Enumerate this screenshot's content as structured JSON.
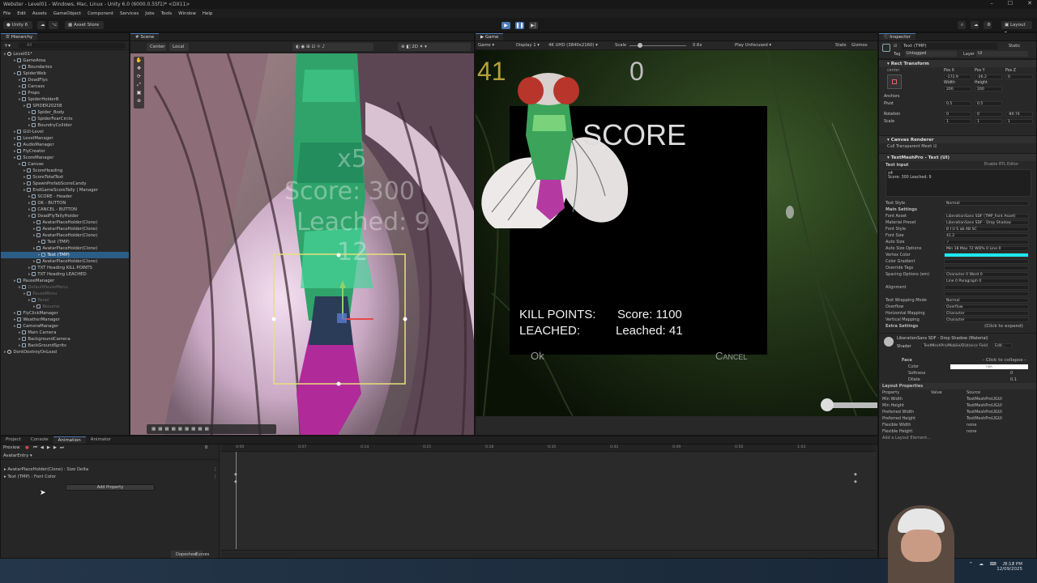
{
  "window": {
    "title": "Webster - Level01 - Windows, Mac, Linux - Unity 6.0 (6000.0.55f1)* <DX11>"
  },
  "menu": [
    "File",
    "Edit",
    "Assets",
    "GameObject",
    "Component",
    "Services",
    "Jobs",
    "Tools",
    "Window",
    "Help"
  ],
  "toolbar": {
    "account": "Unity 6",
    "asset_store": "Asset Store",
    "layout": "Layout"
  },
  "hierarchy": {
    "tab": "Hierarchy",
    "search_placeholder": "All",
    "items": [
      {
        "label": "Level01*",
        "d": 0,
        "t": "scene"
      },
      {
        "label": "GameArea",
        "d": 2
      },
      {
        "label": "Boundaries",
        "d": 3
      },
      {
        "label": "SpiderWeb",
        "d": 2
      },
      {
        "label": "DeadFlys",
        "d": 3
      },
      {
        "label": "Carcass",
        "d": 3
      },
      {
        "label": "Props",
        "d": 3
      },
      {
        "label": "SpiderHolderB",
        "d": 3
      },
      {
        "label": "SPIDER2025B",
        "d": 4
      },
      {
        "label": "Spider_Body",
        "d": 5
      },
      {
        "label": "SpiderFearCircle",
        "d": 5
      },
      {
        "label": "BoundryCollider",
        "d": 5
      },
      {
        "label": "GUI-Level",
        "d": 2
      },
      {
        "label": "LevelManager",
        "d": 2
      },
      {
        "label": "AudioManager",
        "d": 2
      },
      {
        "label": "FlyCreator",
        "d": 2
      },
      {
        "label": "ScoreManager",
        "d": 2
      },
      {
        "label": "Canvas",
        "d": 3
      },
      {
        "label": "ScoreHeading",
        "d": 4
      },
      {
        "label": "ScoreTotalText",
        "d": 4
      },
      {
        "label": "SpawnPrefabScoreCandy",
        "d": 4
      },
      {
        "label": "EndGameScoreTally | Manager",
        "d": 4
      },
      {
        "label": "SCORE - Header",
        "d": 5
      },
      {
        "label": "OK - BUTTON",
        "d": 5
      },
      {
        "label": "CANCEL - BUTTON",
        "d": 5
      },
      {
        "label": "DeadFlyTallyHolder",
        "d": 5
      },
      {
        "label": "AvatarPlaceHolder(Clone)",
        "d": 6
      },
      {
        "label": "AvatarPlaceHolder(Clone)",
        "d": 6
      },
      {
        "label": "AvatarPlaceHolder(Clone)",
        "d": 6
      },
      {
        "label": "Text (TMP)",
        "d": 7
      },
      {
        "label": "AvatarPlaceHolder(Clone)",
        "d": 6
      },
      {
        "label": "Text (TMP)",
        "d": 7,
        "sel": true
      },
      {
        "label": "AvatarPlaceHolder(Clone)",
        "d": 6
      },
      {
        "label": "TXT Heading KILL POINTS",
        "d": 5
      },
      {
        "label": "TXT Heading LEACHED",
        "d": 5
      },
      {
        "label": "PauseManager",
        "d": 2
      },
      {
        "label": "DefaultPauseMenu",
        "d": 3,
        "dim": true
      },
      {
        "label": "PauseMenu",
        "d": 4,
        "dim": true
      },
      {
        "label": "Panel",
        "d": 5,
        "dim": true
      },
      {
        "label": "Resume",
        "d": 6,
        "dim": true
      },
      {
        "label": "FlyClickManager",
        "d": 2
      },
      {
        "label": "WeatherManager",
        "d": 2
      },
      {
        "label": "CameraManager",
        "d": 2
      },
      {
        "label": "Main Camera",
        "d": 3
      },
      {
        "label": "BackgroundCamera",
        "d": 3
      },
      {
        "label": "BackGroundSprits",
        "d": 3
      },
      {
        "label": "DontDestroyOnLoad",
        "d": 0,
        "t": "scene"
      }
    ]
  },
  "scene": {
    "tab": "Scene",
    "pivot": "Center",
    "space": "Local",
    "ghost_lines": [
      "x5",
      "Score: 300",
      "Leached: 9",
      "12"
    ]
  },
  "game": {
    "tab": "Game",
    "mode": "Game",
    "display": "Display 1",
    "resolution": "4K UHD (3840x2160)",
    "scale_label": "Scale",
    "scale_value": "0.6x",
    "play_focus": "Play Unfocused",
    "stats": "Stats",
    "gizmos": "Gizmos",
    "counter_left": "41",
    "counter_center": "0",
    "dialog": {
      "title": "SCORE",
      "kill_label": "KILL POINTS:",
      "kill_value": "Score: 1100",
      "leached_label": "LEACHED:",
      "leached_value": "Leached: 41",
      "ok": "Ok",
      "cancel": "Cancel"
    }
  },
  "inspector": {
    "tab": "Inspector",
    "object_name": "Text (TMP)",
    "static": "Static",
    "tag_label": "Tag",
    "tag": "Untagged",
    "layer_label": "Layer",
    "layer": "UI",
    "rect": {
      "title": "Rect Transform",
      "anchor_label": "center",
      "pos_labels": [
        "Pos X",
        "Pos Y",
        "Pos Z"
      ],
      "pos": [
        "-172.9",
        "-26.2",
        "0"
      ],
      "size_labels": [
        "Width",
        "Height"
      ],
      "size": [
        "200",
        "200"
      ],
      "anchors": "Anchors",
      "pivot_label": "Pivot",
      "pivot": [
        "0.5",
        "0.5"
      ],
      "rotation_label": "Rotation",
      "rotation": [
        "0",
        "0",
        "-80.74"
      ],
      "scale_label": "Scale",
      "scale": [
        "1",
        "1",
        "1"
      ]
    },
    "canvas_renderer": {
      "title": "Canvas Renderer",
      "cull": "Cull Transparent Mesh"
    },
    "tmp": {
      "title": "TextMeshPro - Text (UI)",
      "text_input": "Text Input",
      "rtl": "Enable RTL Editor",
      "text_lines": [
        "x4",
        "Score: 300  Leached: 9"
      ],
      "text_style_label": "Text Style",
      "text_style": "Normal",
      "main_settings": "Main Settings",
      "props": [
        {
          "k": "Font Asset",
          "v": "LiberationSans SDF (TMP_Font Asset)"
        },
        {
          "k": "Material Preset",
          "v": "LiberationSans SDF - Drop Shadow"
        },
        {
          "k": "Font Style",
          "v": "B  I  U  S  ab  AB  SC"
        },
        {
          "k": "Font Size",
          "v": "41.2"
        },
        {
          "k": "Auto Size",
          "v": "✓"
        },
        {
          "k": "Auto Size Options",
          "v": "Min 18   Max 72   WD% 0   Line 0"
        },
        {
          "k": "Vertex Color",
          "v": ""
        },
        {
          "k": "Color Gradient",
          "v": ""
        },
        {
          "k": "Override Tags",
          "v": ""
        },
        {
          "k": "Spacing Options (em)",
          "v": "Character 0   Word 0"
        },
        {
          "k": "",
          "v": "Line 0   Paragraph 0"
        },
        {
          "k": "Alignment",
          "v": ""
        },
        {
          "k": "",
          "v": ""
        },
        {
          "k": "Text Wrapping Mode",
          "v": "Normal"
        },
        {
          "k": "Overflow",
          "v": "Overflow"
        },
        {
          "k": "Horizontal Mapping",
          "v": "Character"
        },
        {
          "k": "Vertical Mapping",
          "v": "Character"
        }
      ],
      "extra": "Extra Settings",
      "extra_hint": "(Click to expand)"
    },
    "material": {
      "name": "LiberationSans SDF - Drop Shadow (Material)",
      "shader_label": "Shader",
      "shader": "TextMeshPro/Mobile/Distance Field",
      "edit": "Edit...",
      "face": "Face",
      "collapse": "- Click to collapse -",
      "color": "Color",
      "hdr": "HDR",
      "softness": "Softness",
      "softness_v": "0",
      "dilate": "Dilate",
      "dilate_v": "0.1"
    },
    "layout": {
      "title": "Layout Properties",
      "headers": [
        "Property",
        "Value",
        "Source"
      ],
      "rows": [
        [
          "Min Width",
          "",
          "TextMeshProUGUI"
        ],
        [
          "Min Height",
          "",
          "TextMeshProUGUI"
        ],
        [
          "Preferred Width",
          "",
          "TextMeshProUGUI"
        ],
        [
          "Preferred Height",
          "",
          "TextMeshProUGUI"
        ],
        [
          "Flexible Width",
          "",
          "none"
        ],
        [
          "Flexible Height",
          "",
          "none"
        ]
      ],
      "add": "Add a Layout Element..."
    }
  },
  "bottom": {
    "tabs": [
      "Project",
      "Console",
      "Animation",
      "Animator"
    ],
    "active": "Animation",
    "preview": "Preview",
    "clip": "AvatarEntry",
    "tracks": [
      "AvatarPlaceHolder(Clone) : Size Delta",
      "Text (TMP) : Font Color"
    ],
    "add_property": "Add Property",
    "ruler": [
      "0:00",
      "0:07",
      "0:14",
      "0:21",
      "0:28",
      "0:35",
      "0:42",
      "0:49",
      "0:56",
      "1:03"
    ],
    "dopesheet": "Dopesheet",
    "curves": "Curves",
    "frame": "0"
  },
  "status": {
    "time": "8:12 PM",
    "date": "12/09/2025"
  },
  "colors": {
    "accent": "#4b7bb5",
    "vertex": "#1de8f0",
    "selection": "#2c5d87"
  }
}
